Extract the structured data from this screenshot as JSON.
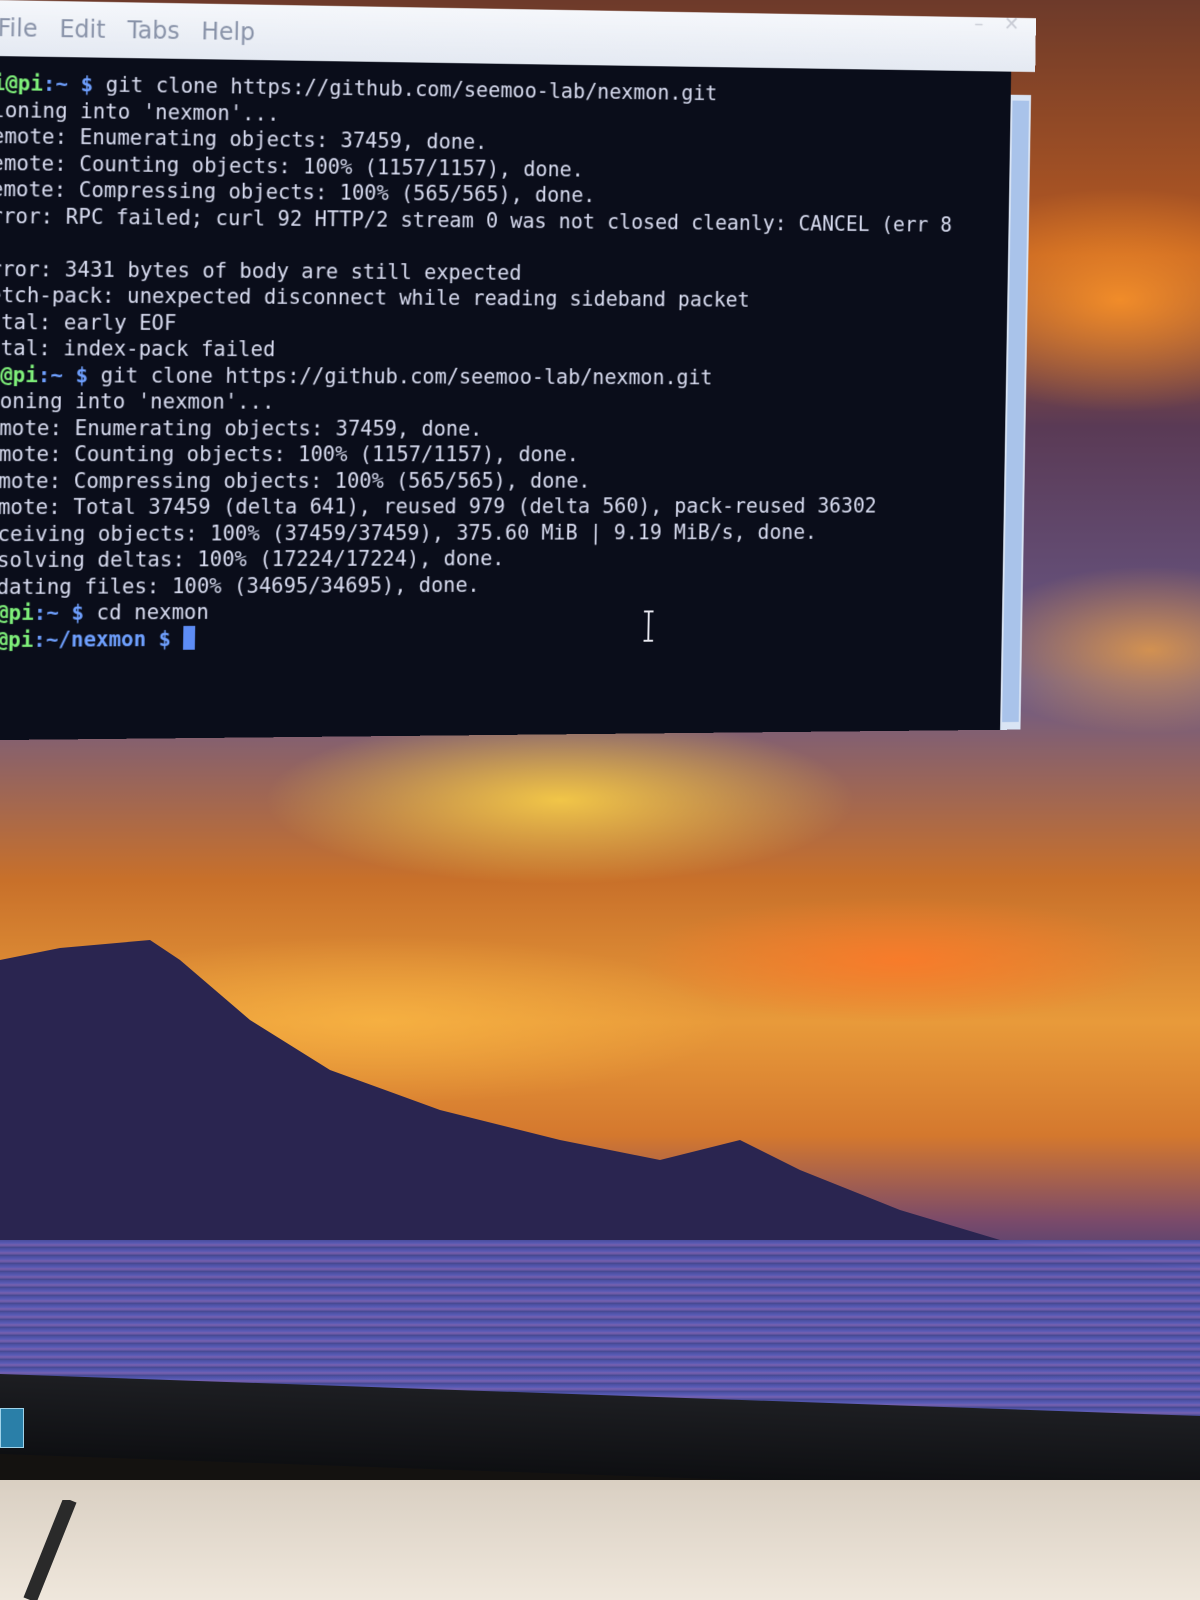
{
  "window": {
    "menu": [
      "File",
      "Edit",
      "Tabs",
      "Help"
    ]
  },
  "terminal": {
    "lines": [
      {
        "user": "i@pi",
        "path": ":~",
        "sym": " $ ",
        "text": "git clone https://github.com/seemoo-lab/nexmon.git"
      },
      {
        "text": "loning into 'nexmon'..."
      },
      {
        "text": "emote: Enumerating objects: 37459, done."
      },
      {
        "text": "emote: Counting objects: 100% (1157/1157), done."
      },
      {
        "text": "emote: Compressing objects: 100% (565/565), done."
      },
      {
        "text": "rror: RPC failed; curl 92 HTTP/2 stream 0 was not closed cleanly: CANCEL (err 8"
      },
      {
        "text": ""
      },
      {
        "text": "rror: 3431 bytes of body are still expected"
      },
      {
        "text": "etch-pack: unexpected disconnect while reading sideband packet"
      },
      {
        "text": "atal: early EOF"
      },
      {
        "text": "atal: index-pack failed"
      },
      {
        "user": "i@pi",
        "path": ":~",
        "sym": " $ ",
        "text": "git clone https://github.com/seemoo-lab/nexmon.git"
      },
      {
        "text": "loning into 'nexmon'..."
      },
      {
        "text": "emote: Enumerating objects: 37459, done."
      },
      {
        "text": "emote: Counting objects: 100% (1157/1157), done."
      },
      {
        "text": "emote: Compressing objects: 100% (565/565), done."
      },
      {
        "text": "emote: Total 37459 (delta 641), reused 979 (delta 560), pack-reused 36302"
      },
      {
        "text": "eceiving objects: 100% (37459/37459), 375.60 MiB | 9.19 MiB/s, done."
      },
      {
        "text": "esolving deltas: 100% (17224/17224), done."
      },
      {
        "text": "pdating files: 100% (34695/34695), done."
      },
      {
        "user": "i@pi",
        "path": ":~",
        "sym": " $ ",
        "text": "cd nexmon"
      },
      {
        "user": "i@pi",
        "path": ":~/nexmon",
        "sym": " $ ",
        "text": "",
        "cursor": true
      }
    ]
  },
  "colors": {
    "terminal_bg": "#0a0d1a",
    "prompt_user": "#7ff07a",
    "prompt_path": "#6fa0ff",
    "output_text": "#d8dcf0"
  },
  "icons": [
    "close-icon",
    "ibeam-cursor-icon",
    "energy-star-logo"
  ]
}
